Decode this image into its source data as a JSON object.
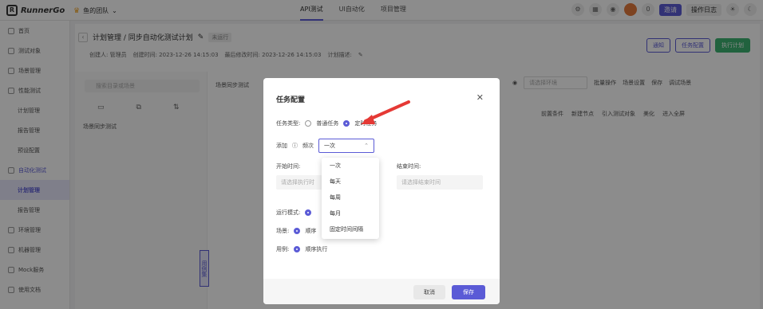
{
  "app": {
    "name": "RunnerGo",
    "team": "鱼的团队"
  },
  "nav": {
    "tabs": [
      "API测试",
      "UI自动化",
      "项目管理"
    ],
    "active": 0
  },
  "header": {
    "notifications": "0",
    "invite": "邀请",
    "oplog": "操作日志"
  },
  "sidebar": {
    "items": [
      {
        "label": "首页"
      },
      {
        "label": "测试对象"
      },
      {
        "label": "场景管理"
      },
      {
        "label": "性能测试"
      },
      {
        "label": "计划管理"
      },
      {
        "label": "报告管理"
      },
      {
        "label": "预设配置"
      },
      {
        "label": "自动化测试"
      },
      {
        "label": "计划管理"
      },
      {
        "label": "报告管理"
      },
      {
        "label": "环境管理"
      },
      {
        "label": "机器管理"
      },
      {
        "label": "Mock服务"
      },
      {
        "label": "使用文档"
      }
    ]
  },
  "main": {
    "crumb": "计划管理 / 同步自动化测试计划",
    "status": "未运行",
    "creator": "创建人: 管理员",
    "created": "创建时间: 2023-12-26 14:15:03",
    "modified": "最后修改时间: 2023-12-26 14:15:03",
    "desc": "计划描述:",
    "btn_notify": "通知",
    "btn_task": "任务配置",
    "btn_run": "执行计划",
    "search_ph": "搜索目录或场景",
    "scene_item": "场景同步测试",
    "scene_head": "场景同步测试",
    "env_ph": "请选择环境",
    "batch": "批量操作",
    "scene_set": "场景设置",
    "save": "保存",
    "debug": "调试场景",
    "t_pre": "前置条件",
    "t_node": "新建节点",
    "t_import": "引入测试对象",
    "t_beauty": "美化",
    "t_full": "进入全屏",
    "vtab": "用例集"
  },
  "modal": {
    "title": "任务配置",
    "type_label": "任务类型:",
    "type_normal": "普通任务",
    "type_timed": "定时任务",
    "add_label": "添加",
    "freq_label": "频次",
    "freq_value": "一次",
    "start_label": "开始时间:",
    "start_ph": "请选择执行时",
    "end_label": "结束时间:",
    "end_ph": "请选择结束时间",
    "run_mode_label": "运行模式:",
    "scene_label": "场景:",
    "scene_value": "顺序",
    "case_label": "用例:",
    "case_value": "顺序执行",
    "freq_options": [
      "一次",
      "每天",
      "每周",
      "每月",
      "固定时间间隔"
    ],
    "cancel": "取消",
    "save": "保存"
  },
  "colors": {
    "accent": "#5b5bd6",
    "green": "#3cb371",
    "arrow": "#e53935"
  }
}
